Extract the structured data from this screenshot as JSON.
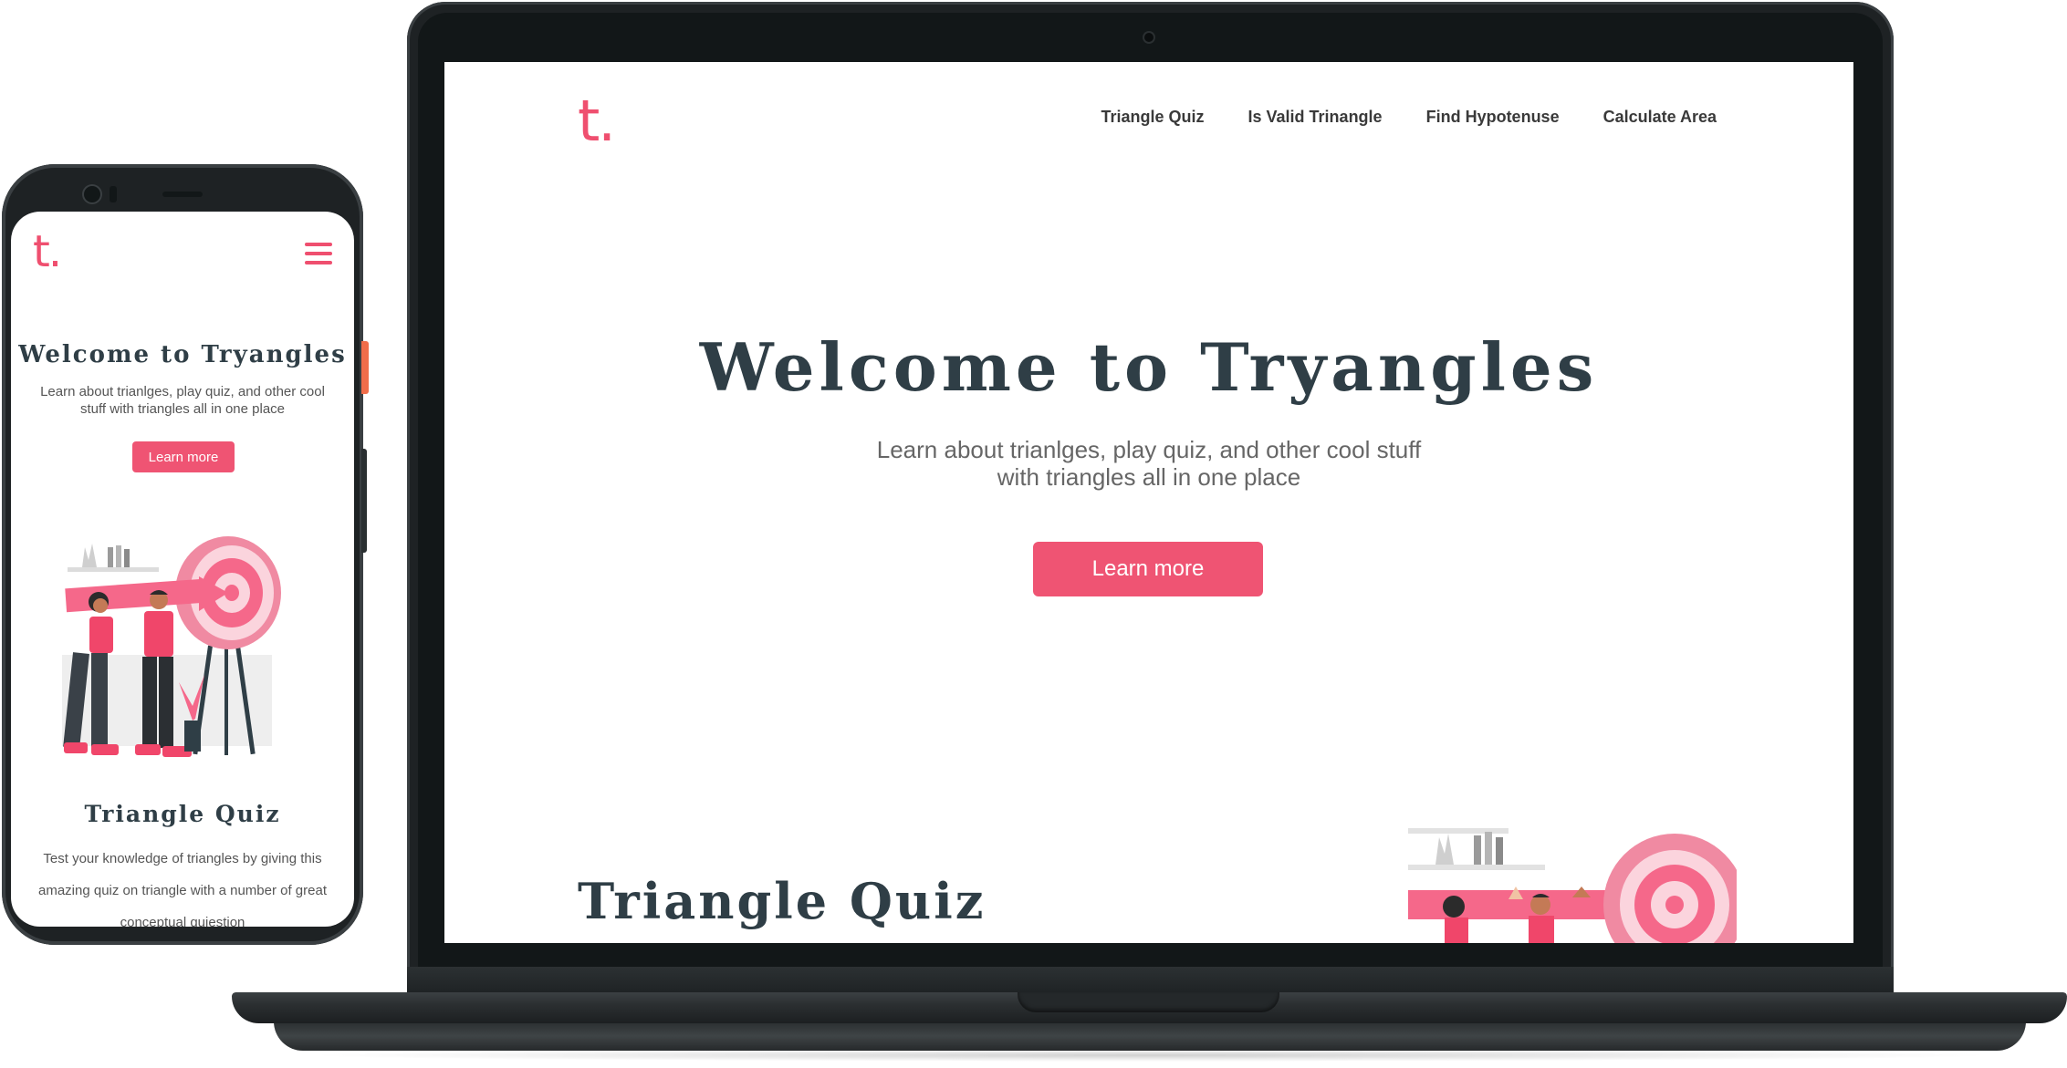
{
  "site": {
    "logo": "t.",
    "nav": [
      "Triangle Quiz",
      "Is Valid Trinangle",
      "Find Hypotenuse",
      "Calculate Area"
    ],
    "hero_title": "Welcome to Tryangles",
    "hero_subtitle": "Learn about trianlges, play quiz, and other cool stuff with triangles all in one place",
    "cta_label": "Learn more",
    "quiz_section_title": "Triangle Quiz",
    "quiz_section_text": "Test your knowledge of triangles by giving this amazing quiz on triangle with a number of great conceptual quiestion"
  },
  "theme": {
    "accent": "#ef5473",
    "heading": "#2f3e46",
    "device_frame": "#1e2224"
  },
  "icons": {
    "menu": "hamburger-menu-icon",
    "illustration": "people-carrying-arrow-to-target-illustration"
  }
}
